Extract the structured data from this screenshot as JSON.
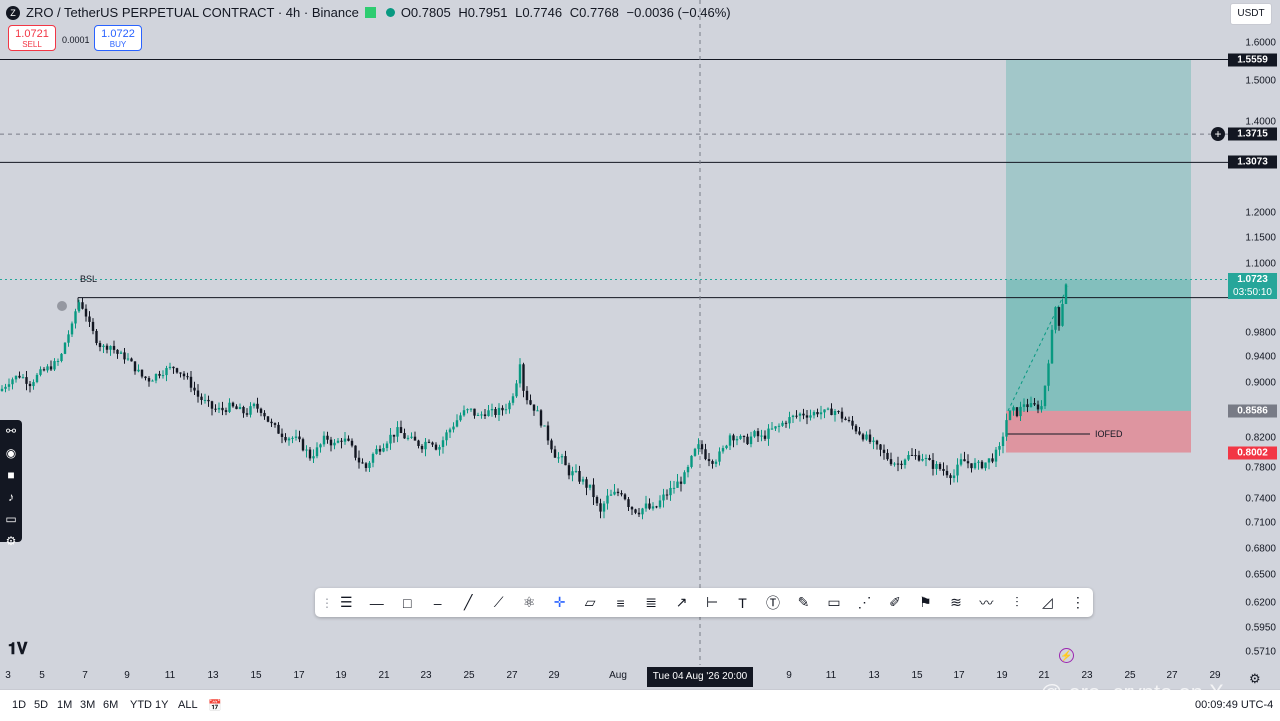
{
  "header": {
    "symbol_icon": "Z",
    "title": "ZRO / TetherUS PERPETUAL CONTRACT · 4h · Binance",
    "ohlc": [
      "O0.7805",
      "H0.7951",
      "L0.7746",
      "C0.7768",
      "−0.0036 (−0.46%)"
    ]
  },
  "trade": {
    "sell_price": "1.0721",
    "sell_label": "SELL",
    "spread": "0.0001",
    "buy_price": "1.0722",
    "buy_label": "BUY"
  },
  "currency_select": "USDT",
  "price_axis": {
    "labels": [
      "1.6000",
      "1.5000",
      "1.4000",
      "1.2000",
      "1.1500",
      "1.1000",
      "0.9800",
      "0.9400",
      "0.9000",
      "0.8200",
      "0.7800",
      "0.7400",
      "0.7100",
      "0.6800",
      "0.6500",
      "0.6200",
      "0.5950",
      "0.5710"
    ],
    "tags": {
      "upper_line": "1.5559",
      "crosshair": "1.3715",
      "mid_line": "1.3073",
      "current_price": "1.0723",
      "countdown": "03:50:10",
      "entry": "0.8586",
      "stop": "0.8002"
    }
  },
  "time_axis": {
    "labels": [
      "3",
      "5",
      "7",
      "9",
      "11",
      "13",
      "15",
      "17",
      "19",
      "21",
      "23",
      "25",
      "27",
      "29",
      "Aug",
      "9",
      "11",
      "13",
      "15",
      "17",
      "19",
      "21",
      "23",
      "25",
      "27",
      "29"
    ],
    "crosshair": "Tue 04 Aug '26   20:00"
  },
  "annotations": {
    "bsl": "BSL",
    "iofed": "IOFED"
  },
  "bottom_bar": {
    "ranges": [
      "1D",
      "5D",
      "1M",
      "3M",
      "6M",
      "YTD",
      "1Y",
      "ALL"
    ],
    "clock": "00:09:49 UTC-4"
  },
  "watermark": "@ ero_crypto on X",
  "colors": {
    "background": "#d1d4dc",
    "profit": "#26a69a",
    "loss": "#f23645",
    "candle": "#131722",
    "candle_up": "#089981"
  },
  "chart_data": {
    "type": "candlestick",
    "title": "ZRO / TetherUS PERPETUAL CONTRACT · 4h · Binance",
    "series": [
      {
        "name": "ZRO/USDT",
        "points": [
          [
            0,
            0.888
          ],
          [
            10,
            0.905
          ],
          [
            20,
            0.912
          ],
          [
            30,
            0.9
          ],
          [
            40,
            0.915
          ],
          [
            50,
            0.925
          ],
          [
            60,
            0.935
          ],
          [
            66,
            0.97
          ],
          [
            72,
            0.99
          ],
          [
            78,
            1.035
          ],
          [
            84,
            1.02
          ],
          [
            90,
            0.99
          ],
          [
            96,
            0.97
          ],
          [
            102,
            0.955
          ],
          [
            110,
            0.96
          ],
          [
            118,
            0.945
          ],
          [
            126,
            0.94
          ],
          [
            134,
            0.925
          ],
          [
            142,
            0.91
          ],
          [
            150,
            0.905
          ],
          [
            158,
            0.915
          ],
          [
            166,
            0.92
          ],
          [
            174,
            0.925
          ],
          [
            182,
            0.915
          ],
          [
            190,
            0.9
          ],
          [
            198,
            0.88
          ],
          [
            206,
            0.87
          ],
          [
            214,
            0.86
          ],
          [
            222,
            0.86
          ],
          [
            230,
            0.865
          ],
          [
            238,
            0.86
          ],
          [
            246,
            0.855
          ],
          [
            254,
            0.865
          ],
          [
            262,
            0.86
          ],
          [
            270,
            0.84
          ],
          [
            278,
            0.83
          ],
          [
            286,
            0.822
          ],
          [
            294,
            0.82
          ],
          [
            302,
            0.81
          ],
          [
            310,
            0.795
          ],
          [
            318,
            0.805
          ],
          [
            326,
            0.822
          ],
          [
            334,
            0.81
          ],
          [
            342,
            0.82
          ],
          [
            350,
            0.81
          ],
          [
            358,
            0.79
          ],
          [
            366,
            0.78
          ],
          [
            374,
            0.8
          ],
          [
            382,
            0.81
          ],
          [
            390,
            0.822
          ],
          [
            398,
            0.83
          ],
          [
            406,
            0.82
          ],
          [
            414,
            0.815
          ],
          [
            422,
            0.81
          ],
          [
            430,
            0.82
          ],
          [
            438,
            0.805
          ],
          [
            446,
            0.825
          ],
          [
            454,
            0.84
          ],
          [
            462,
            0.855
          ],
          [
            470,
            0.86
          ],
          [
            478,
            0.85
          ],
          [
            486,
            0.858
          ],
          [
            494,
            0.855
          ],
          [
            502,
            0.86
          ],
          [
            510,
            0.87
          ],
          [
            516,
            0.9
          ],
          [
            520,
            0.935
          ],
          [
            524,
            0.885
          ],
          [
            530,
            0.87
          ],
          [
            536,
            0.86
          ],
          [
            542,
            0.84
          ],
          [
            548,
            0.82
          ],
          [
            556,
            0.795
          ],
          [
            562,
            0.79
          ],
          [
            568,
            0.775
          ],
          [
            576,
            0.77
          ],
          [
            584,
            0.76
          ],
          [
            592,
            0.75
          ],
          [
            600,
            0.72
          ],
          [
            606,
            0.74
          ],
          [
            614,
            0.745
          ],
          [
            622,
            0.75
          ],
          [
            630,
            0.73
          ],
          [
            638,
            0.725
          ],
          [
            646,
            0.73
          ],
          [
            654,
            0.725
          ],
          [
            662,
            0.74
          ],
          [
            670,
            0.75
          ],
          [
            678,
            0.76
          ],
          [
            686,
            0.77
          ],
          [
            694,
            0.8
          ],
          [
            700,
            0.81
          ],
          [
            706,
            0.795
          ],
          [
            714,
            0.79
          ],
          [
            722,
            0.8
          ],
          [
            730,
            0.825
          ],
          [
            738,
            0.82
          ],
          [
            746,
            0.815
          ],
          [
            754,
            0.825
          ],
          [
            762,
            0.82
          ],
          [
            770,
            0.83
          ],
          [
            778,
            0.835
          ],
          [
            786,
            0.845
          ],
          [
            794,
            0.85
          ],
          [
            802,
            0.855
          ],
          [
            810,
            0.853
          ],
          [
            818,
            0.858
          ],
          [
            826,
            0.855
          ],
          [
            834,
            0.86
          ],
          [
            842,
            0.85
          ],
          [
            850,
            0.84
          ],
          [
            858,
            0.83
          ],
          [
            866,
            0.82
          ],
          [
            874,
            0.81
          ],
          [
            882,
            0.8
          ],
          [
            890,
            0.79
          ],
          [
            898,
            0.785
          ],
          [
            906,
            0.795
          ],
          [
            914,
            0.795
          ],
          [
            922,
            0.795
          ],
          [
            930,
            0.785
          ],
          [
            938,
            0.78
          ],
          [
            946,
            0.775
          ],
          [
            954,
            0.77
          ],
          [
            962,
            0.79
          ],
          [
            970,
            0.785
          ],
          [
            978,
            0.782
          ],
          [
            986,
            0.787
          ],
          [
            994,
            0.795
          ],
          [
            1000,
            0.805
          ],
          [
            1006,
            0.845
          ],
          [
            1012,
            0.86
          ],
          [
            1018,
            0.855
          ],
          [
            1024,
            0.87
          ],
          [
            1030,
            0.865
          ],
          [
            1036,
            0.865
          ],
          [
            1042,
            0.865
          ],
          [
            1048,
            0.93
          ],
          [
            1052,
            0.98
          ],
          [
            1056,
            1.03
          ],
          [
            1060,
            0.985
          ],
          [
            1064,
            1.06
          ],
          [
            1068,
            1.072
          ]
        ]
      }
    ],
    "y_scale": "log",
    "ylim": [
      0.56,
      1.62
    ],
    "position": {
      "entry": 0.8586,
      "target": 1.5559,
      "stop": 0.8002
    },
    "levels": [
      1.5559,
      1.3073,
      1.04
    ],
    "grid": false
  }
}
